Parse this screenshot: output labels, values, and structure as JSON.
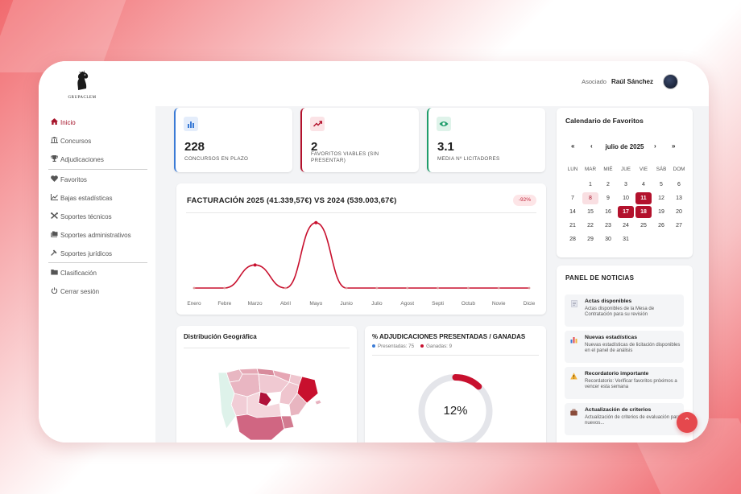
{
  "header": {
    "logo_text": "GRUPACLEM",
    "user_role": "Asociado",
    "user_name": "Raúl Sánchez"
  },
  "sidebar": {
    "items": [
      {
        "label": "Inicio",
        "icon": "home-icon",
        "active": true
      },
      {
        "label": "Concursos",
        "icon": "bank-icon"
      },
      {
        "label": "Adjudicaciones",
        "icon": "trophy-icon"
      },
      {
        "label": "Favoritos",
        "icon": "heart-icon"
      },
      {
        "label": "Bajas estadísticas",
        "icon": "chart-line-icon"
      },
      {
        "label": "Soportes técnicos",
        "icon": "tools-icon"
      },
      {
        "label": "Soportes administrativos",
        "icon": "folders-icon"
      },
      {
        "label": "Soportes jurídicos",
        "icon": "gavel-icon"
      },
      {
        "label": "Clasificación",
        "icon": "folder-icon"
      },
      {
        "label": "Cerrar sesión",
        "icon": "power-icon"
      }
    ]
  },
  "stats": [
    {
      "value": "228",
      "label": "CONCURSOS EN PLAZO",
      "icon": "bar-chart-icon",
      "color": "#3b7bd6"
    },
    {
      "value": "2",
      "label": "FAVORITOS VIABLES (SIN PRESENTAR)",
      "icon": "trend-up-icon",
      "color": "#b3112c"
    },
    {
      "value": "3.1",
      "label": "MEDIA Nº LICITADORES",
      "icon": "eye-icon",
      "color": "#1f9d6b"
    }
  ],
  "billing": {
    "title": "FACTURACIÓN 2025 (41.339,57€) VS 2024 (539.003,67€)",
    "badge": "-92%"
  },
  "chart_data": {
    "type": "line",
    "categories": [
      "Enero",
      "Febre",
      "Marzo",
      "Abril",
      "Mayo",
      "Junio",
      "Julio",
      "Agost",
      "Septi",
      "Octub",
      "Novie",
      "Dicie"
    ],
    "series": [
      {
        "values": [
          0,
          0,
          12000,
          0,
          34000,
          0,
          0,
          0,
          0,
          0,
          0,
          0
        ]
      }
    ],
    "ylim": [
      0,
      36000
    ],
    "grid": false,
    "line_color": "#c8102e"
  },
  "geo": {
    "title": "Distribución Geográfica"
  },
  "adjudicaciones": {
    "title": "% ADJUDICACIONES PRESENTADAS / GANADAS",
    "legend_presented": "Presentadas: 75",
    "legend_won": "Ganadas: 9",
    "percent_label": "12%",
    "percent": 12,
    "presented_color": "#3b7bd6",
    "won_color": "#c8102e"
  },
  "calendar": {
    "title": "Calendario de Favoritos",
    "prev_year": "«",
    "prev_month": "‹",
    "month_label": "julio de 2025",
    "next_month": "›",
    "next_year": "»",
    "weekdays": [
      "LUN",
      "MAR",
      "MIÉ",
      "JUE",
      "VIE",
      "SÁB",
      "DOM"
    ],
    "leading_blanks": 1,
    "days": 31,
    "favorite_days": [
      8
    ],
    "highlight_days": [
      11,
      17,
      18
    ]
  },
  "news": {
    "title": "PANEL DE NOTICIAS",
    "items": [
      {
        "icon": "document-icon",
        "title": "Actas disponibles",
        "text": "Actas disponibles de la Mesa de Contratación para su revisión"
      },
      {
        "icon": "stats-icon",
        "title": "Nuevas estadísticas",
        "text": "Nuevas estadísticas de licitación disponibles en el panel de análisis"
      },
      {
        "icon": "warning-icon",
        "title": "Recordatorio importante",
        "text": "Recordatorio: Verificar favoritos próximos a vencer esta semana"
      },
      {
        "icon": "briefcase-icon",
        "title": "Actualización de criterios",
        "text": "Actualización de criterios de evaluación para nuevos..."
      }
    ]
  },
  "fab": {
    "icon": "chevron-up-icon",
    "glyph": "⌃"
  }
}
